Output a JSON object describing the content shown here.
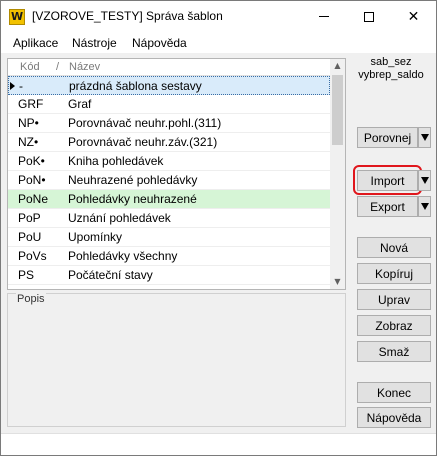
{
  "window": {
    "title": "[VZOROVE_TESTY] Správa šablon",
    "app_icon_text": "W"
  },
  "menu": [
    "Aplikace",
    "Nástroje",
    "Nápověda"
  ],
  "grid": {
    "headers": {
      "code": "Kód",
      "sort_marker": "/",
      "name": "Název"
    },
    "rows": [
      {
        "code": "-",
        "name": "prázdná šablona sestavy",
        "state": "selected"
      },
      {
        "code": "GRF",
        "name": "Graf"
      },
      {
        "code": "NP•",
        "name": "Porovnávač neuhr.pohl.(311)"
      },
      {
        "code": "NZ•",
        "name": "Porovnávač neuhr.záv.(321)"
      },
      {
        "code": "PoK•",
        "name": "Kniha pohledávek"
      },
      {
        "code": "PoN•",
        "name": "Neuhrazené pohledávky"
      },
      {
        "code": "PoNe",
        "name": "Pohledávky neuhrazené",
        "state": "highlight"
      },
      {
        "code": "PoP",
        "name": "Uznání pohledávek"
      },
      {
        "code": "PoU",
        "name": "Upomínky"
      },
      {
        "code": "PoVs",
        "name": "Pohledávky všechny"
      },
      {
        "code": "PS",
        "name": "Počáteční stavy"
      }
    ]
  },
  "popis": {
    "label": "Popis"
  },
  "info": {
    "line1": "sab_sez",
    "line2": "vybrep_saldo"
  },
  "buttons": {
    "porovnej": "Porovnej",
    "import": "Import",
    "export": "Export",
    "nova": "Nová",
    "kopiruj": "Kopíruj",
    "uprav": "Uprav",
    "zobraz": "Zobraz",
    "smaz": "Smaž",
    "konec": "Konec",
    "napoveda": "Nápověda"
  },
  "colors": {
    "selected_row": "#d9ebfa",
    "highlight_row": "#d6f5d6",
    "annotation_ring": "#e0161c",
    "app_icon": "#f2c200"
  }
}
